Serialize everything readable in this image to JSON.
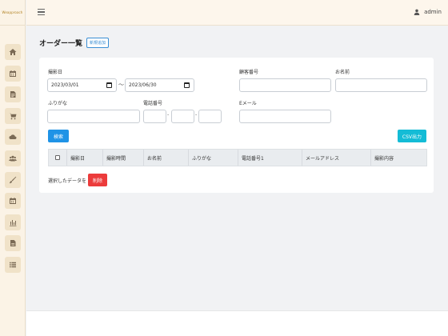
{
  "app": {
    "brand": "Weapproach"
  },
  "topbar": {
    "user": "admin"
  },
  "page": {
    "title": "オーダー一覧",
    "new_button": "新規追加"
  },
  "form": {
    "shooting_date_label": "撮影日",
    "date_from": "2023/03/01",
    "date_separator": "〜",
    "date_to": "2023/06/30",
    "customer_number_label": "顧客番号",
    "customer_number_value": "",
    "name_label": "お名前",
    "name_value": "",
    "furigana_label": "ふりがな",
    "furigana_value": "",
    "phone_label": "電話番号",
    "phone_sep1": "-",
    "phone_sep2": "-",
    "email_label": "Eメール",
    "email_value": ""
  },
  "buttons": {
    "search": "検索",
    "csv": "CSV出力",
    "delete": "削除"
  },
  "table": {
    "columns": [
      "撮影日",
      "撮影時間",
      "お名前",
      "ふりがな",
      "電話番号1",
      "メールアドレス",
      "撮影内容"
    ]
  },
  "selected": {
    "text": "選択したデータを"
  },
  "sidebar_icons": [
    "home-icon",
    "calendar-icon",
    "document-icon",
    "cart-icon",
    "cloud-icon",
    "users-icon",
    "brush-icon",
    "calendar-icon",
    "chart-icon",
    "file-icon",
    "list-icon"
  ]
}
